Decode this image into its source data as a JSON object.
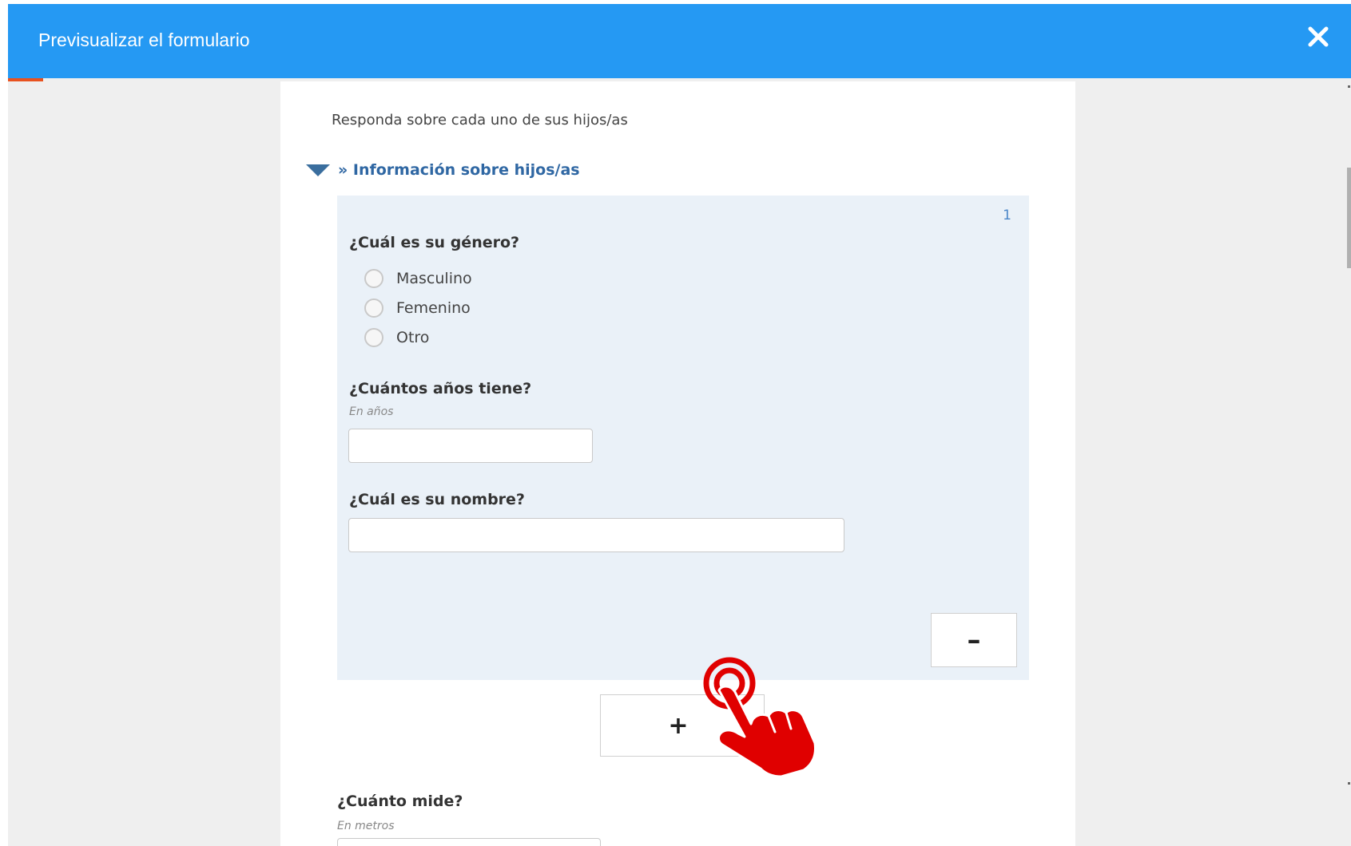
{
  "header": {
    "title": "Previsualizar el formulario",
    "close_icon": "close-icon"
  },
  "form": {
    "intro": "Responda sobre cada uno de sus hijos/as",
    "section": {
      "label": "» Información sobre hijos/as",
      "icon": "collapse-triangle-icon"
    },
    "group": {
      "number": "1",
      "q_gender": "¿Cuál es su género?",
      "gender_options": [
        "Masculino",
        "Femenino",
        "Otro"
      ],
      "q_age": "¿Cuántos años tiene?",
      "age_hint": "En años",
      "age_value": "",
      "q_name": "¿Cuál es su nombre?",
      "name_value": "",
      "remove_label": "–"
    },
    "add_label": "+",
    "q_height": "¿Cuánto mide?",
    "height_hint": "En metros",
    "height_value": ""
  },
  "colors": {
    "header": "#2599f3",
    "accent_orange": "#e8521f",
    "group_bg": "#eaf1f8",
    "pointer": "#e00000"
  }
}
